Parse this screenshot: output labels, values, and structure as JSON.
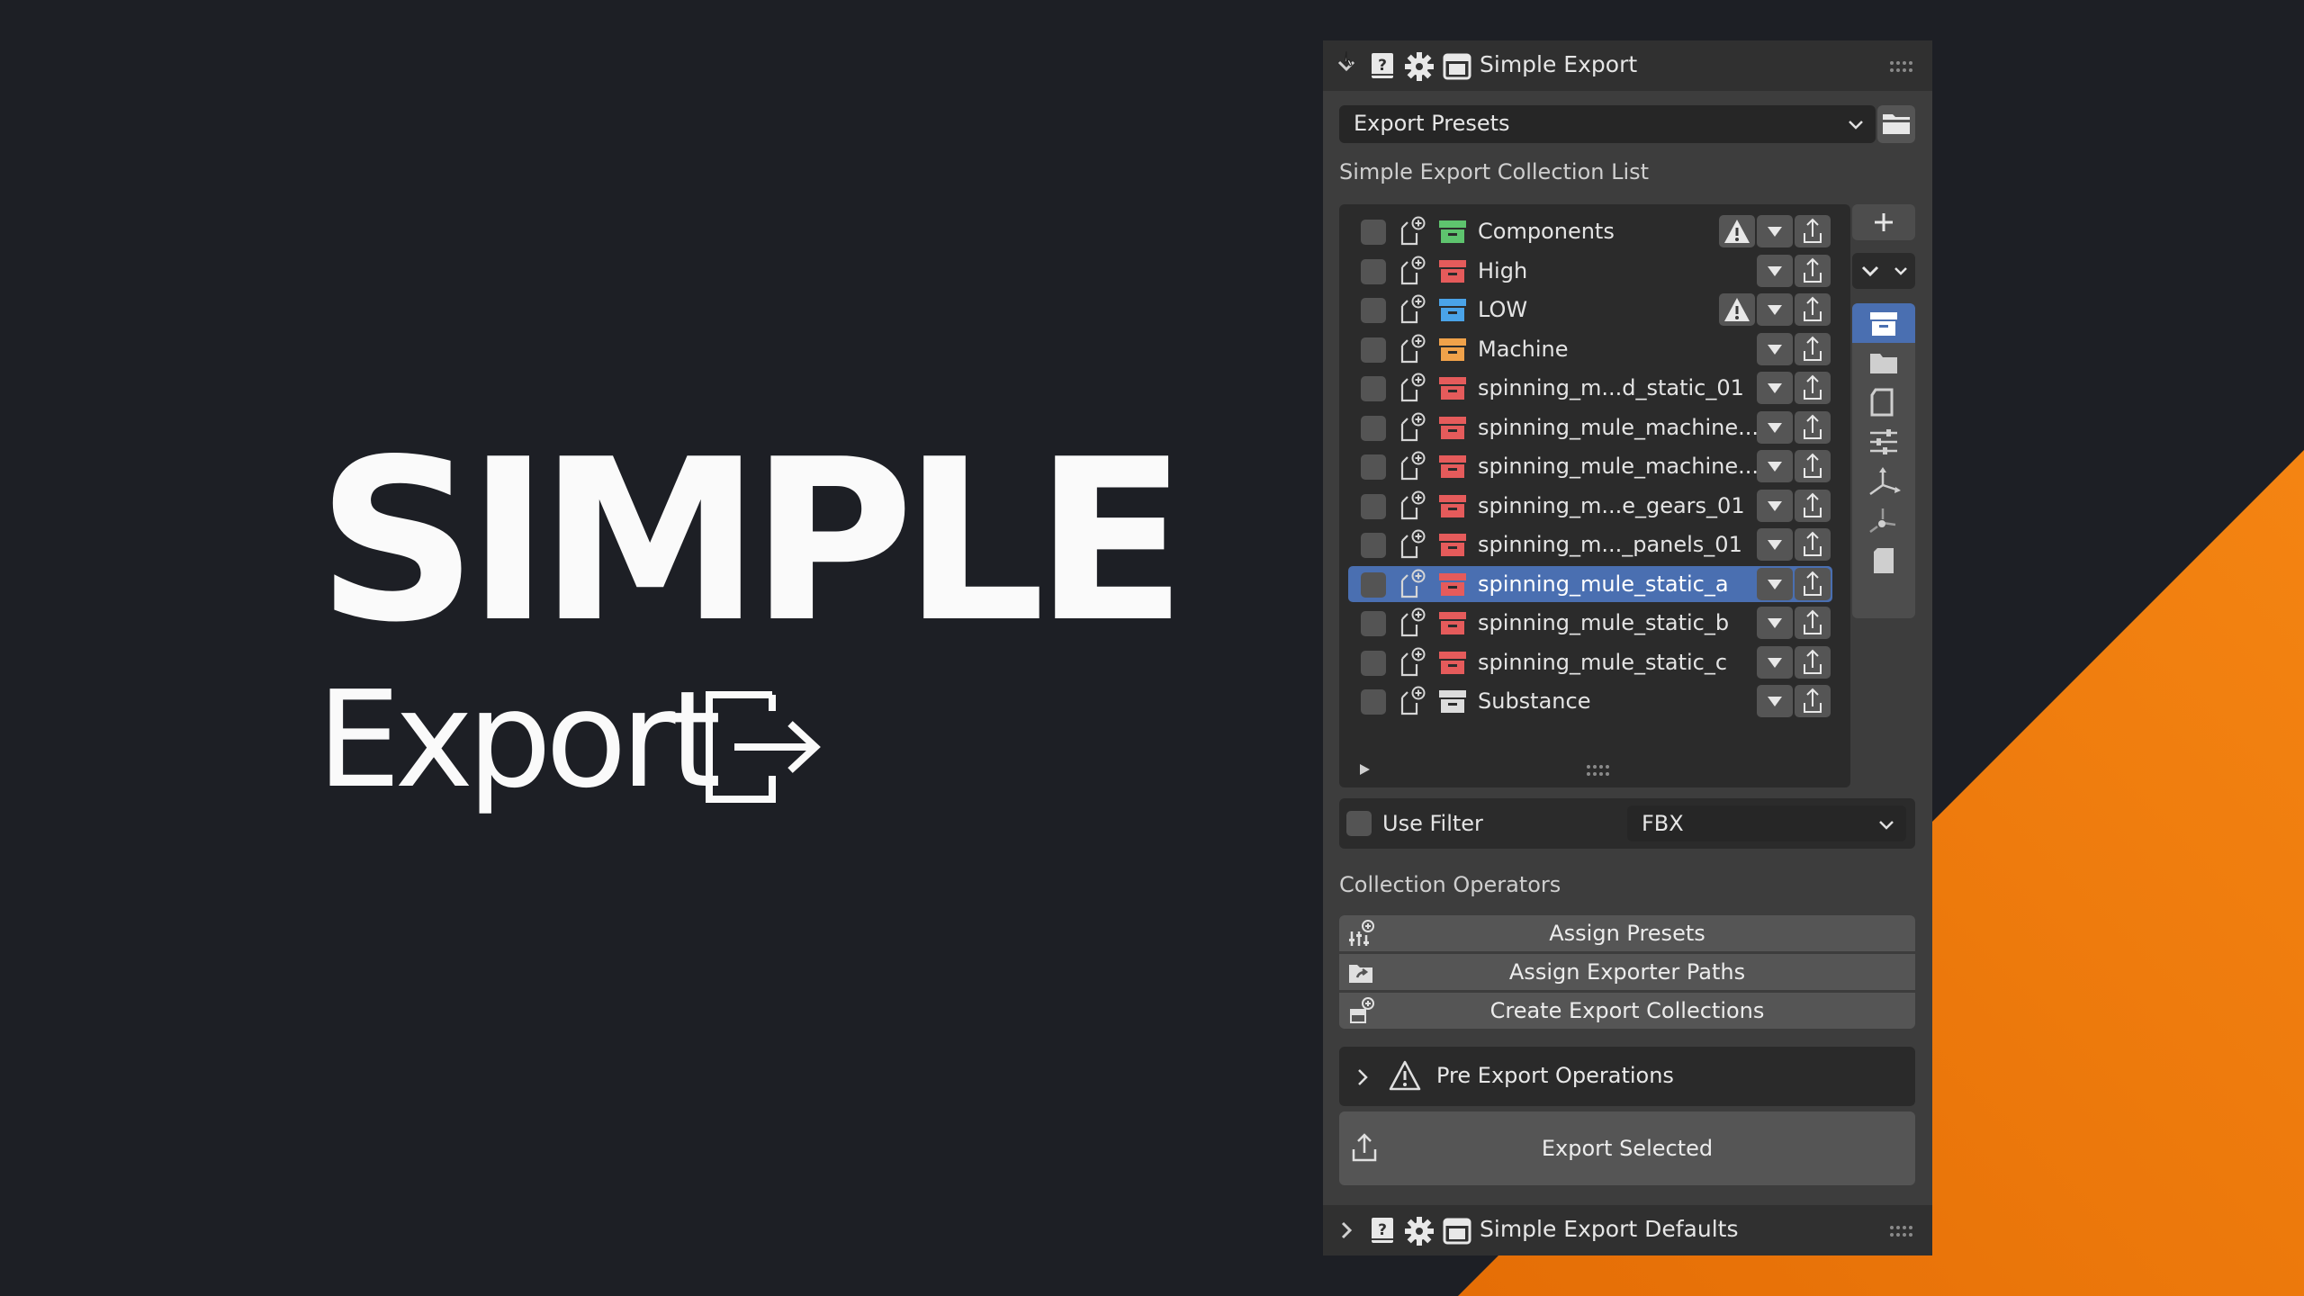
{
  "hero": {
    "title": "SIMPLE",
    "subtitle": "Export"
  },
  "panel": {
    "title": "Simple Export",
    "preset_dropdown": "Export Presets",
    "list_label": "Simple Export Collection List",
    "collections": [
      {
        "name": "Components",
        "color": "#5ec46e",
        "warning": true,
        "selected": false
      },
      {
        "name": "High",
        "color": "#e55b5b",
        "warning": false,
        "selected": false
      },
      {
        "name": "LOW",
        "color": "#4aa3e8",
        "warning": true,
        "selected": false
      },
      {
        "name": "Machine",
        "color": "#f0a24a",
        "warning": false,
        "selected": false
      },
      {
        "name": "spinning_m...d_static_01",
        "color": "#e55b5b",
        "warning": false,
        "selected": false
      },
      {
        "name": "spinning_mule_machine...",
        "color": "#e55b5b",
        "warning": false,
        "selected": false
      },
      {
        "name": "spinning_mule_machine...",
        "color": "#e55b5b",
        "warning": false,
        "selected": false
      },
      {
        "name": "spinning_m...e_gears_01",
        "color": "#e55b5b",
        "warning": false,
        "selected": false
      },
      {
        "name": "spinning_m..._panels_01",
        "color": "#e55b5b",
        "warning": false,
        "selected": false
      },
      {
        "name": "spinning_mule_static_a",
        "color": "#e55b5b",
        "warning": false,
        "selected": true
      },
      {
        "name": "spinning_mule_static_b",
        "color": "#e55b5b",
        "warning": false,
        "selected": false
      },
      {
        "name": "spinning_mule_static_c",
        "color": "#e55b5b",
        "warning": false,
        "selected": false
      },
      {
        "name": "Substance",
        "color": "#dcdcdc",
        "warning": false,
        "selected": false
      }
    ],
    "use_filter_label": "Use Filter",
    "filter_value": "FBX",
    "operators_label": "Collection Operators",
    "operators": [
      "Assign Presets",
      "Assign Exporter Paths",
      "Create Export Collections"
    ],
    "pre_export_label": "Pre Export Operations",
    "export_button": "Export Selected",
    "defaults_title": "Simple Export Defaults"
  },
  "colors": {
    "accent": "#4a6fb1",
    "orange": "#f07d0a",
    "background": "#1d1f25"
  }
}
